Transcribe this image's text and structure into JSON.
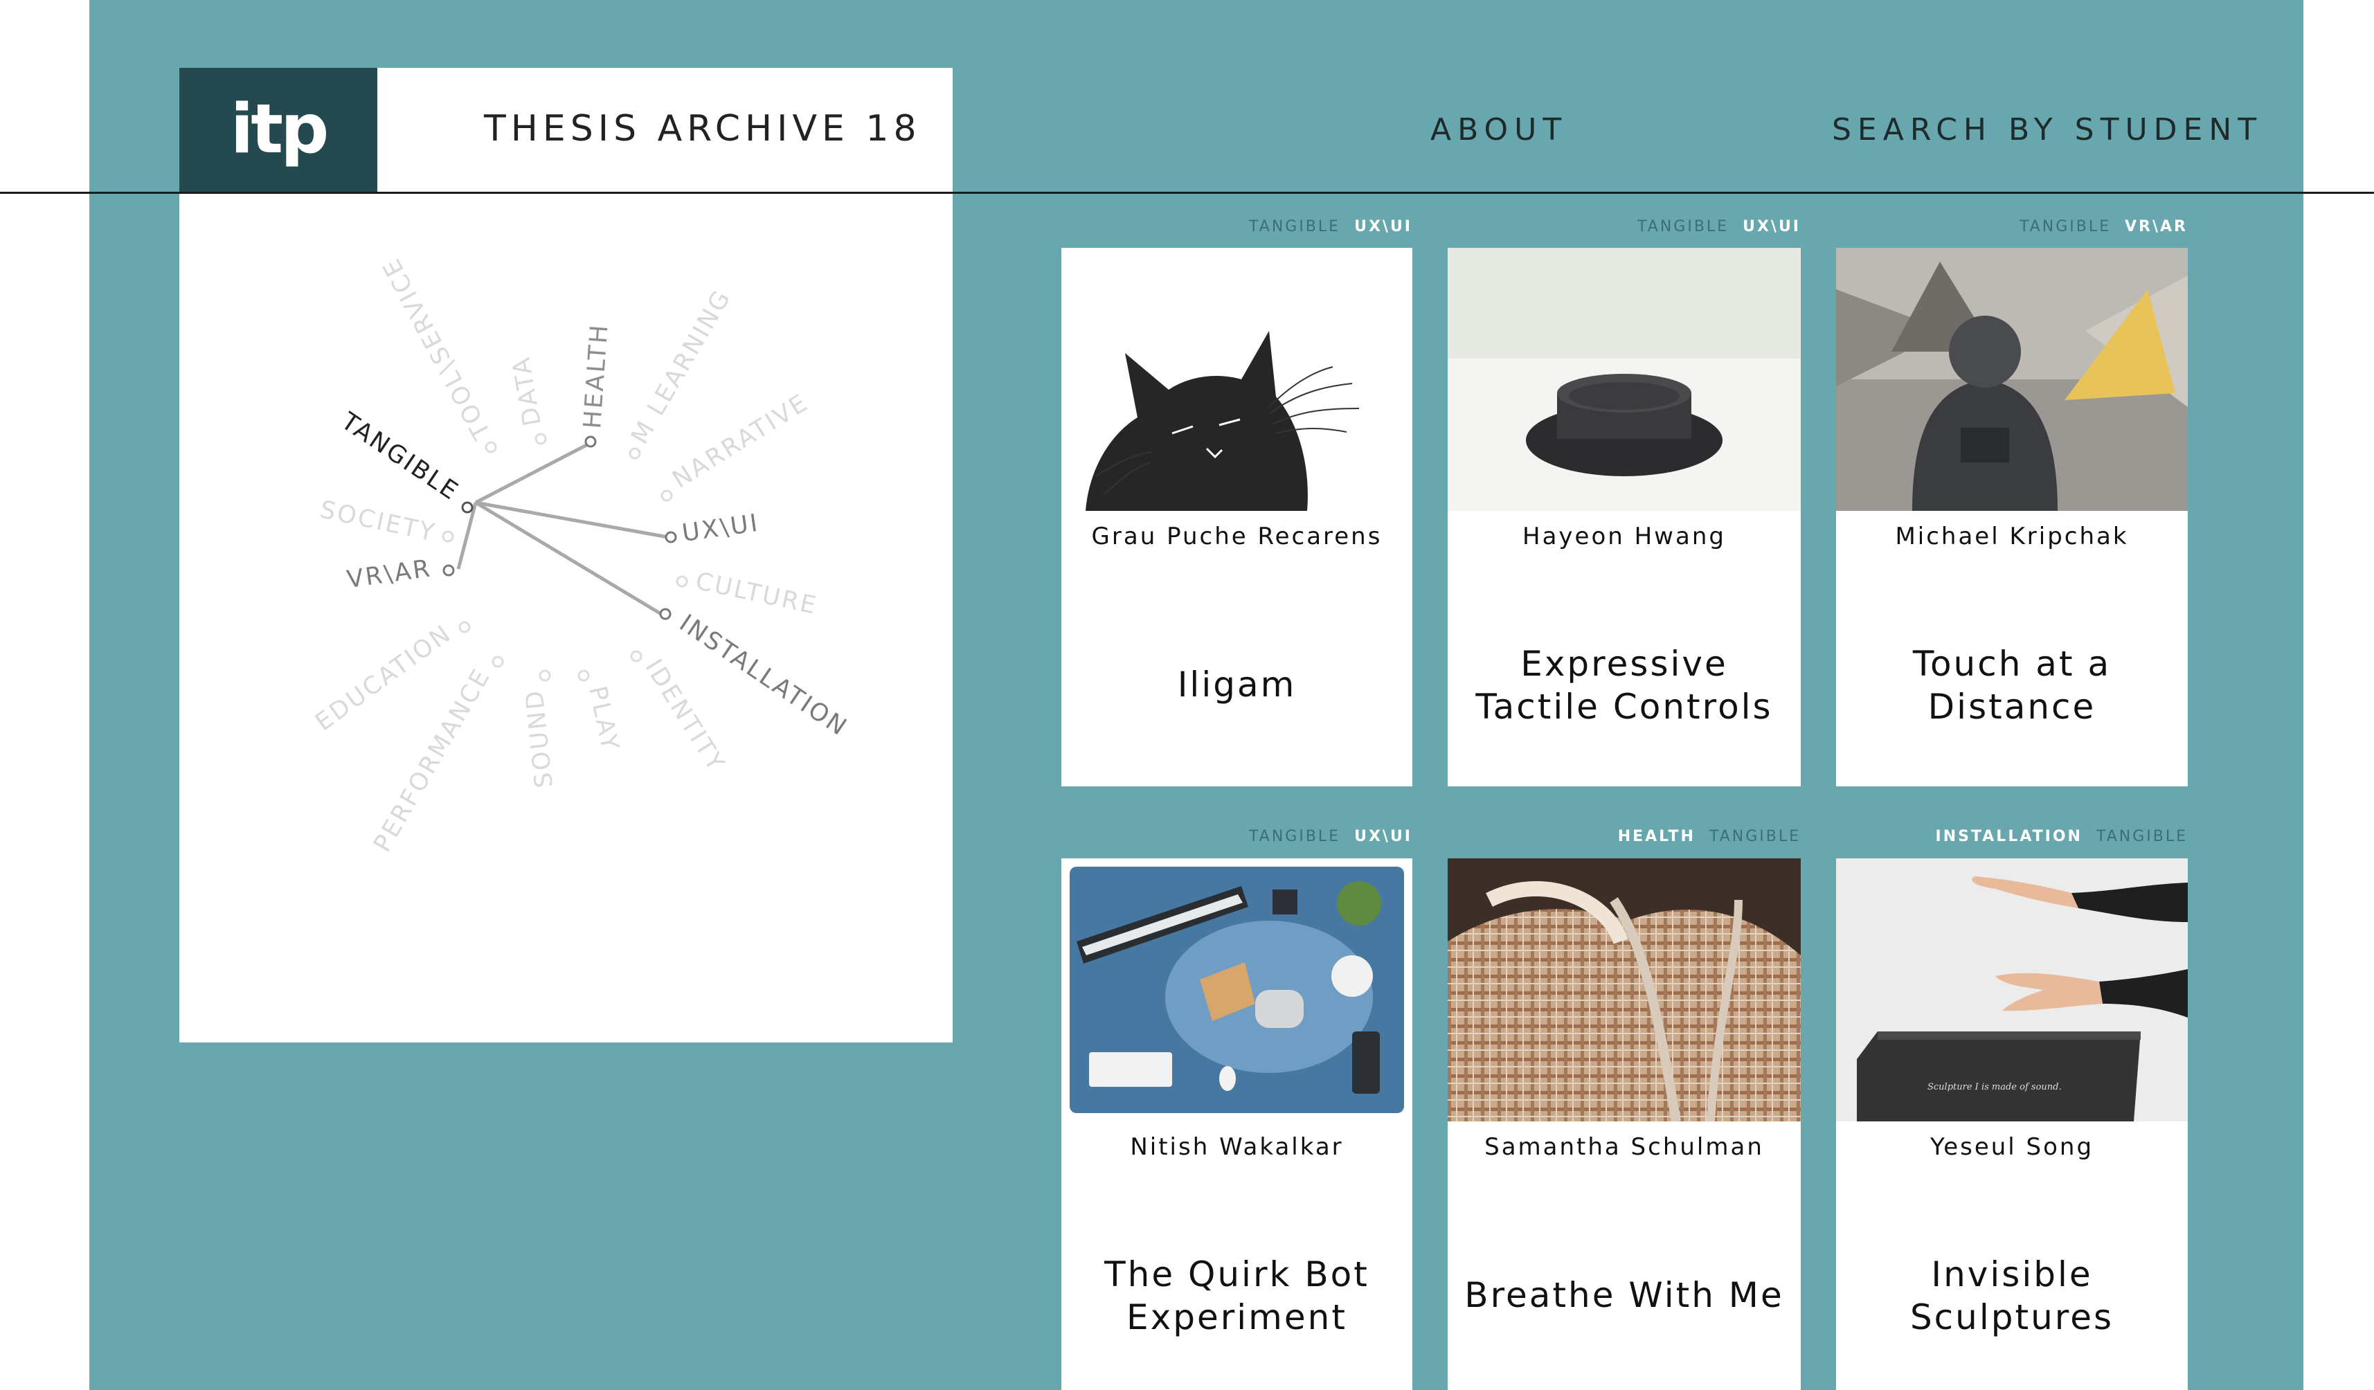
{
  "header": {
    "logo_text": "itp",
    "site_title": "THESIS ARCHIVE 18",
    "nav": {
      "about": "ABOUT",
      "search": "SEARCH BY STUDENT"
    }
  },
  "wheel": {
    "labels": {
      "tool_service": "TOOL\\SERVICE",
      "data": "DATA",
      "health": "HEALTH",
      "m_learning": "M LEARNING",
      "narrative": "NARRATIVE",
      "tangible": "TANGIBLE",
      "ux_ui": "UX\\UI",
      "society": "SOCIETY",
      "vr_ar": "VR\\AR",
      "culture": "CULTURE",
      "installation": "INSTALLATION",
      "education": "EDUCATION",
      "identity": "IDENTITY",
      "performance": "PERFORMANCE",
      "play": "PLAY",
      "sound": "SOUND"
    }
  },
  "cards": [
    {
      "tag1": "TANGIBLE",
      "tag2": "UX\\UI",
      "student": "Grau Puche Recarens",
      "title": "Iligam",
      "image": "black cat illustration"
    },
    {
      "tag1": "TANGIBLE",
      "tag2": "UX\\UI",
      "student": "Hayeon Hwang",
      "title": "Expressive\nTactile Controls",
      "image": "black rubber button"
    },
    {
      "tag1": "TANGIBLE",
      "tag2": "VR\\AR",
      "student": "Michael Kripchak",
      "title": "Touch at a\nDistance",
      "image": "person with yellow cone"
    },
    {
      "tag1": "TANGIBLE",
      "tag2": "UX\\UI",
      "student": "Nitish Wakalkar",
      "title": "The Quirk Bot\nExperiment",
      "image": "desk top view"
    },
    {
      "tag1": "HEALTH",
      "tag2": "TANGIBLE",
      "student": "Samantha Schulman",
      "title": "Breathe With Me",
      "image": "plaid garment with tube"
    },
    {
      "tag1": "INSTALLATION",
      "tag2": "TANGIBLE",
      "student": "Yeseul Song",
      "title": "Invisible\nSculptures",
      "image": "hands over black box",
      "box_caption": "Sculpture I is made of sound."
    }
  ],
  "colors": {
    "teal": "#68a7ae",
    "logo_bg": "#24494f",
    "tag_dim": "#3c6f74",
    "wheel_active": "#222222",
    "wheel_inactive": "#d9d9d9",
    "wheel_mid": "#8d8d8d"
  }
}
